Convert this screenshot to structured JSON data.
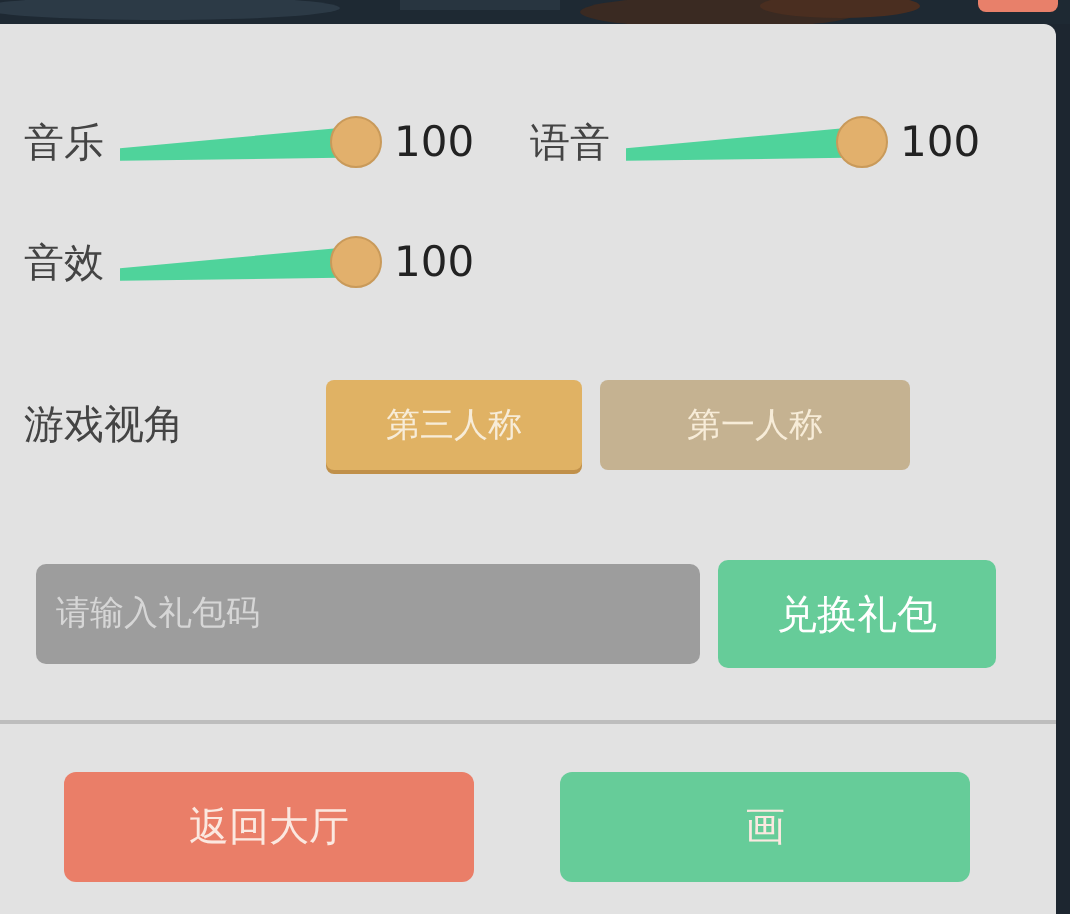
{
  "sliders": [
    {
      "label": "音乐",
      "level": 1,
      "reading": "100"
    },
    {
      "label": "语音",
      "level": 1,
      "reading": "100"
    },
    {
      "label": "音效",
      "level": 1,
      "reading": "100"
    }
  ],
  "view": {
    "label": "游戏视角",
    "options": [
      {
        "label": "第三人称",
        "selected": true
      },
      {
        "label": "第一人称",
        "selected": false
      }
    ]
  },
  "gift": {
    "placeholder": "请输入礼包码",
    "button": "兑换礼包"
  },
  "buttons": [
    {
      "label": "返回大厅",
      "kind": "danger"
    },
    {
      "label": "画",
      "kind": "confirm"
    }
  ]
}
